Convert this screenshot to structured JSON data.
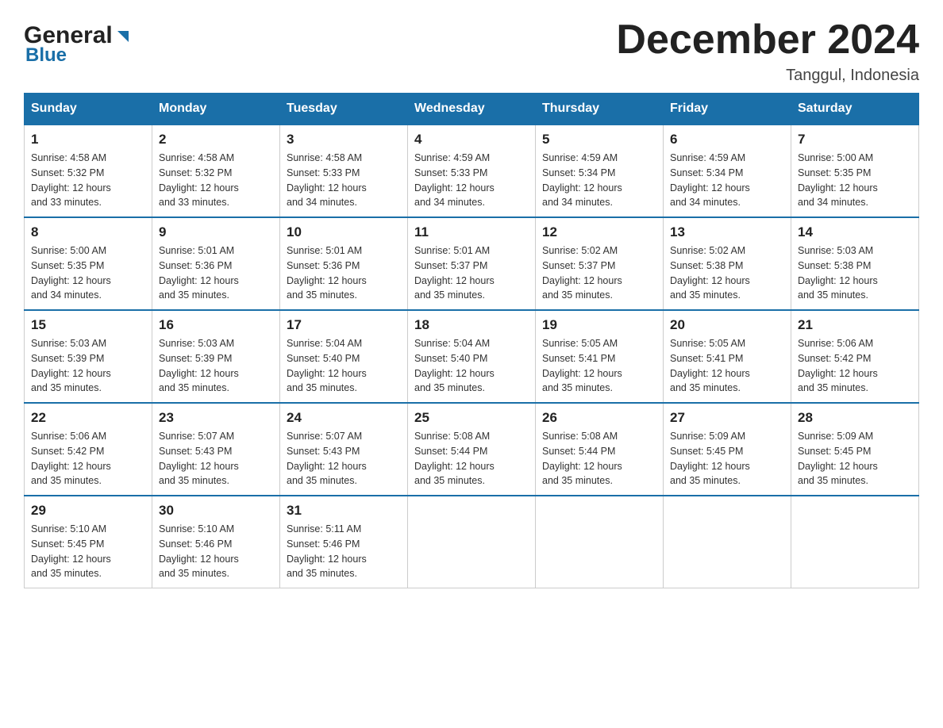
{
  "header": {
    "logo_general": "General",
    "logo_blue": "Blue",
    "month_title": "December 2024",
    "location": "Tanggul, Indonesia"
  },
  "days_of_week": [
    "Sunday",
    "Monday",
    "Tuesday",
    "Wednesday",
    "Thursday",
    "Friday",
    "Saturday"
  ],
  "weeks": [
    [
      {
        "day": "1",
        "sunrise": "4:58 AM",
        "sunset": "5:32 PM",
        "daylight": "12 hours and 33 minutes."
      },
      {
        "day": "2",
        "sunrise": "4:58 AM",
        "sunset": "5:32 PM",
        "daylight": "12 hours and 33 minutes."
      },
      {
        "day": "3",
        "sunrise": "4:58 AM",
        "sunset": "5:33 PM",
        "daylight": "12 hours and 34 minutes."
      },
      {
        "day": "4",
        "sunrise": "4:59 AM",
        "sunset": "5:33 PM",
        "daylight": "12 hours and 34 minutes."
      },
      {
        "day": "5",
        "sunrise": "4:59 AM",
        "sunset": "5:34 PM",
        "daylight": "12 hours and 34 minutes."
      },
      {
        "day": "6",
        "sunrise": "4:59 AM",
        "sunset": "5:34 PM",
        "daylight": "12 hours and 34 minutes."
      },
      {
        "day": "7",
        "sunrise": "5:00 AM",
        "sunset": "5:35 PM",
        "daylight": "12 hours and 34 minutes."
      }
    ],
    [
      {
        "day": "8",
        "sunrise": "5:00 AM",
        "sunset": "5:35 PM",
        "daylight": "12 hours and 34 minutes."
      },
      {
        "day": "9",
        "sunrise": "5:01 AM",
        "sunset": "5:36 PM",
        "daylight": "12 hours and 35 minutes."
      },
      {
        "day": "10",
        "sunrise": "5:01 AM",
        "sunset": "5:36 PM",
        "daylight": "12 hours and 35 minutes."
      },
      {
        "day": "11",
        "sunrise": "5:01 AM",
        "sunset": "5:37 PM",
        "daylight": "12 hours and 35 minutes."
      },
      {
        "day": "12",
        "sunrise": "5:02 AM",
        "sunset": "5:37 PM",
        "daylight": "12 hours and 35 minutes."
      },
      {
        "day": "13",
        "sunrise": "5:02 AM",
        "sunset": "5:38 PM",
        "daylight": "12 hours and 35 minutes."
      },
      {
        "day": "14",
        "sunrise": "5:03 AM",
        "sunset": "5:38 PM",
        "daylight": "12 hours and 35 minutes."
      }
    ],
    [
      {
        "day": "15",
        "sunrise": "5:03 AM",
        "sunset": "5:39 PM",
        "daylight": "12 hours and 35 minutes."
      },
      {
        "day": "16",
        "sunrise": "5:03 AM",
        "sunset": "5:39 PM",
        "daylight": "12 hours and 35 minutes."
      },
      {
        "day": "17",
        "sunrise": "5:04 AM",
        "sunset": "5:40 PM",
        "daylight": "12 hours and 35 minutes."
      },
      {
        "day": "18",
        "sunrise": "5:04 AM",
        "sunset": "5:40 PM",
        "daylight": "12 hours and 35 minutes."
      },
      {
        "day": "19",
        "sunrise": "5:05 AM",
        "sunset": "5:41 PM",
        "daylight": "12 hours and 35 minutes."
      },
      {
        "day": "20",
        "sunrise": "5:05 AM",
        "sunset": "5:41 PM",
        "daylight": "12 hours and 35 minutes."
      },
      {
        "day": "21",
        "sunrise": "5:06 AM",
        "sunset": "5:42 PM",
        "daylight": "12 hours and 35 minutes."
      }
    ],
    [
      {
        "day": "22",
        "sunrise": "5:06 AM",
        "sunset": "5:42 PM",
        "daylight": "12 hours and 35 minutes."
      },
      {
        "day": "23",
        "sunrise": "5:07 AM",
        "sunset": "5:43 PM",
        "daylight": "12 hours and 35 minutes."
      },
      {
        "day": "24",
        "sunrise": "5:07 AM",
        "sunset": "5:43 PM",
        "daylight": "12 hours and 35 minutes."
      },
      {
        "day": "25",
        "sunrise": "5:08 AM",
        "sunset": "5:44 PM",
        "daylight": "12 hours and 35 minutes."
      },
      {
        "day": "26",
        "sunrise": "5:08 AM",
        "sunset": "5:44 PM",
        "daylight": "12 hours and 35 minutes."
      },
      {
        "day": "27",
        "sunrise": "5:09 AM",
        "sunset": "5:45 PM",
        "daylight": "12 hours and 35 minutes."
      },
      {
        "day": "28",
        "sunrise": "5:09 AM",
        "sunset": "5:45 PM",
        "daylight": "12 hours and 35 minutes."
      }
    ],
    [
      {
        "day": "29",
        "sunrise": "5:10 AM",
        "sunset": "5:45 PM",
        "daylight": "12 hours and 35 minutes."
      },
      {
        "day": "30",
        "sunrise": "5:10 AM",
        "sunset": "5:46 PM",
        "daylight": "12 hours and 35 minutes."
      },
      {
        "day": "31",
        "sunrise": "5:11 AM",
        "sunset": "5:46 PM",
        "daylight": "12 hours and 35 minutes."
      },
      null,
      null,
      null,
      null
    ]
  ],
  "labels": {
    "sunrise": "Sunrise:",
    "sunset": "Sunset:",
    "daylight": "Daylight:"
  }
}
